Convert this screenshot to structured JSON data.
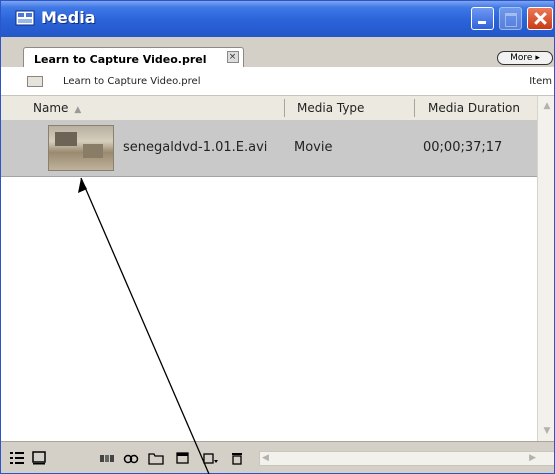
{
  "window": {
    "title": "Media",
    "icon": "media-window-icon",
    "controls": [
      "minimize",
      "maximize",
      "close"
    ]
  },
  "tab": {
    "label": "Learn to Capture Video.prel",
    "close_glyph": "×",
    "more_label": "More ▸"
  },
  "bin": {
    "label": "Learn to Capture Video.prel",
    "items_label": "Item"
  },
  "columns": {
    "name": "Name",
    "media_type": "Media Type",
    "media_duration": "Media Duration"
  },
  "rows": [
    {
      "name": "senegaldvd-1.01.E.avi",
      "media_type": "Movie",
      "media_duration": "00;00;37;17"
    }
  ],
  "bottom_toolbar": {
    "icons": [
      "list-view-icon",
      "icon-view-icon",
      "automate-to-sequence-icon",
      "find-icon",
      "new-bin-icon",
      "new-item-icon",
      "clear-icon"
    ]
  },
  "colors": {
    "titlebar": "#2458c9",
    "row_selected": "#c9c9c9",
    "chrome": "#d4d0c8"
  }
}
